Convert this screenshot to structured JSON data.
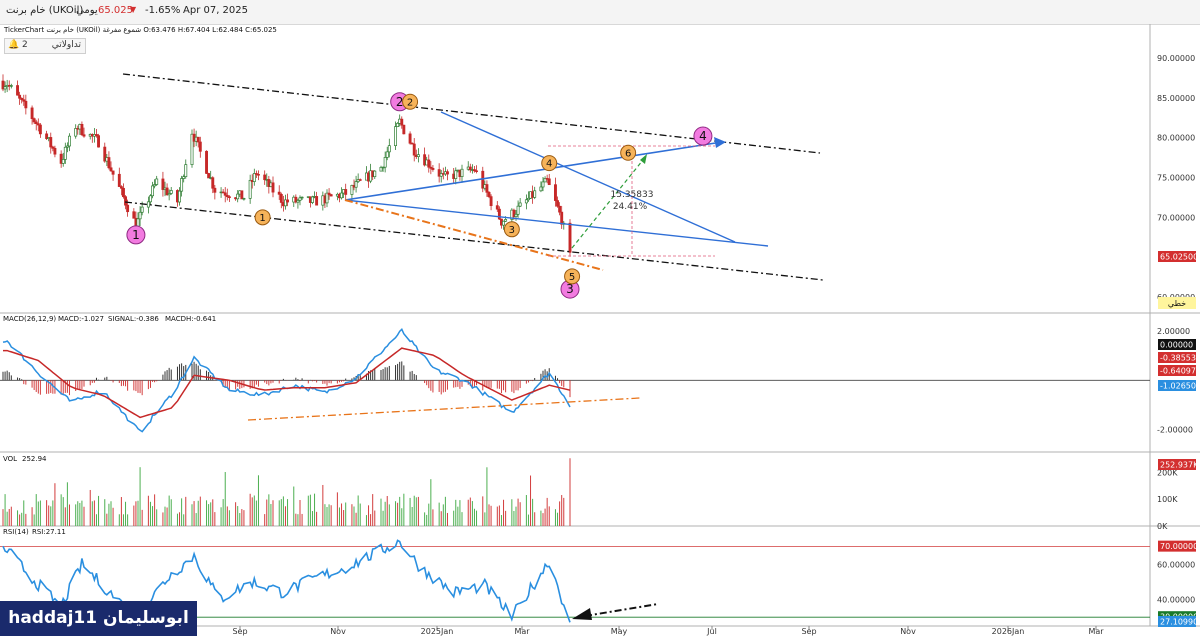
{
  "header": {
    "symbol_label": "خام برنت (UKOil)",
    "period": "يومي",
    "last_price": "65.025",
    "change_pct": "-1.65%",
    "date": "Apr 07, 2025",
    "ohlc_line": "TickerChart  خام برنت (UKOil)  شموع مفرغة  O:63.476  H:67.404  L:62.484  C:65.025",
    "trade_button": "تداولاتي",
    "alerts_count": "2",
    "down_color": "#d32f2f"
  },
  "watermark": "haddaj11 ابوسليمان",
  "chart_data": [
    {
      "type": "candlestick",
      "name": "price",
      "ylim": [
        58,
        93
      ],
      "y_ticks": [
        "90.00000",
        "85.00000",
        "80.00000",
        "75.00000",
        "70.00000",
        "60.00000"
      ],
      "last_value_label": "65.02500",
      "line_style_label": "خطي",
      "x_ticks": [
        "Sep",
        "Nov",
        "2025Jan",
        "Mar",
        "May",
        "Jul",
        "Sep",
        "Nov",
        "2026Jan",
        "Mar"
      ],
      "anchor_closes": [
        [
          "2024-07-10",
          86.8
        ],
        [
          "2024-07-25",
          81.5
        ],
        [
          "2024-08-05",
          77.0
        ],
        [
          "2024-08-12",
          81.5
        ],
        [
          "2024-08-23",
          79.5
        ],
        [
          "2024-09-10",
          69.0
        ],
        [
          "2024-09-20",
          74.5
        ],
        [
          "2024-09-30",
          72.0
        ],
        [
          "2024-10-07",
          80.8
        ],
        [
          "2024-10-18",
          73.5
        ],
        [
          "2024-11-01",
          72.5
        ],
        [
          "2024-11-07",
          75.6
        ],
        [
          "2024-11-20",
          72.0
        ],
        [
          "2024-12-05",
          72.0
        ],
        [
          "2024-12-20",
          73.0
        ],
        [
          "2025-01-06",
          76.3
        ],
        [
          "2025-01-15",
          82.0
        ],
        [
          "2025-01-22",
          78.5
        ],
        [
          "2025-02-05",
          75.0
        ],
        [
          "2025-02-20",
          76.0
        ],
        [
          "2025-03-05",
          69.5
        ],
        [
          "2025-03-12",
          70.8
        ],
        [
          "2025-03-27",
          74.5
        ],
        [
          "2025-04-03",
          69.8
        ],
        [
          "2025-04-07",
          65.0
        ]
      ],
      "measure": {
        "value": "15.35833",
        "percent": "24.41%"
      },
      "waves_big": [
        {
          "label": "1",
          "date": "2024-09-10",
          "value": 67.8
        },
        {
          "label": "2",
          "date": "2025-01-15",
          "value": 84.5
        },
        {
          "label": "3",
          "date": "2025-04-07",
          "value": 61.0
        },
        {
          "label": "4",
          "date": "2025-06-10",
          "value": 80.2
        }
      ],
      "waves_small": [
        {
          "label": "1",
          "date": "2024-11-10",
          "value": 70.0
        },
        {
          "label": "2",
          "date": "2025-01-20",
          "value": 84.5
        },
        {
          "label": "3",
          "date": "2025-03-10",
          "value": 68.5
        },
        {
          "label": "4",
          "date": "2025-03-28",
          "value": 76.8
        },
        {
          "label": "5",
          "date": "2025-04-08",
          "value": 62.6
        },
        {
          "label": "6",
          "date": "2025-05-05",
          "value": 78.1
        }
      ]
    },
    {
      "type": "line",
      "name": "MACD",
      "label": "MACD(26,12,9)",
      "macd_text": "MACD:-1.027",
      "signal_text": "SIGNAL:-0.386",
      "hist_text": "MACDH:-0.641",
      "ylim": [
        -2.9,
        2.6
      ],
      "y_ticks": [
        "2.00000",
        "-2.00000"
      ],
      "value_labels": [
        "0.00000",
        "-0.38553",
        "-0.64097",
        "-1.02650"
      ],
      "macd_anchors": [
        [
          "2024-07-10",
          1.6
        ],
        [
          "2024-07-25",
          0.3
        ],
        [
          "2024-08-10",
          -0.9
        ],
        [
          "2024-08-25",
          -0.4
        ],
        [
          "2024-09-12",
          -2.1
        ],
        [
          "2024-09-28",
          -0.5
        ],
        [
          "2024-10-08",
          0.9
        ],
        [
          "2024-10-25",
          -0.4
        ],
        [
          "2024-11-10",
          -0.6
        ],
        [
          "2024-11-25",
          -0.2
        ],
        [
          "2024-12-10",
          -0.5
        ],
        [
          "2024-12-25",
          0.1
        ],
        [
          "2025-01-16",
          2.0
        ],
        [
          "2025-02-01",
          0.4
        ],
        [
          "2025-02-15",
          0.0
        ],
        [
          "2025-03-10",
          -1.3
        ],
        [
          "2025-03-28",
          0.3
        ],
        [
          "2025-04-07",
          -1.0
        ]
      ],
      "signal_anchors": [
        [
          "2024-07-10",
          1.2
        ],
        [
          "2024-07-25",
          0.8
        ],
        [
          "2024-08-10",
          -0.3
        ],
        [
          "2024-08-25",
          -0.6
        ],
        [
          "2024-09-12",
          -1.5
        ],
        [
          "2024-09-28",
          -1.1
        ],
        [
          "2024-10-08",
          0.2
        ],
        [
          "2024-10-25",
          0.0
        ],
        [
          "2024-11-10",
          -0.4
        ],
        [
          "2024-11-25",
          -0.3
        ],
        [
          "2024-12-10",
          -0.3
        ],
        [
          "2024-12-25",
          -0.1
        ],
        [
          "2025-01-16",
          1.3
        ],
        [
          "2025-02-01",
          1.0
        ],
        [
          "2025-02-15",
          0.2
        ],
        [
          "2025-03-10",
          -0.8
        ],
        [
          "2025-03-28",
          -0.2
        ],
        [
          "2025-04-07",
          -0.4
        ]
      ]
    },
    {
      "type": "bar",
      "name": "volume",
      "label": "VOL",
      "value_text": "252.94",
      "y_ticks": [
        "200K",
        "100K",
        "0K"
      ],
      "last_value_label": "252.937K",
      "ylim": [
        0,
        265
      ],
      "base_volume": 90,
      "last_volume": 252.9
    },
    {
      "type": "line",
      "name": "RSI",
      "label": "RSI(14)",
      "value_text": "RSI:27.11",
      "ylim": [
        25,
        80
      ],
      "y_ticks": [
        "60.00000",
        "40.00000"
      ],
      "levels": [
        "70.00000",
        "30.00000"
      ],
      "last_value_label": "27.10990",
      "anchors": [
        [
          "2024-07-10",
          68
        ],
        [
          "2024-07-22",
          52
        ],
        [
          "2024-08-05",
          36
        ],
        [
          "2024-08-15",
          60
        ],
        [
          "2024-08-25",
          48
        ],
        [
          "2024-09-10",
          30
        ],
        [
          "2024-09-25",
          52
        ],
        [
          "2024-10-08",
          65
        ],
        [
          "2024-10-20",
          40
        ],
        [
          "2024-11-05",
          50
        ],
        [
          "2024-11-20",
          44
        ],
        [
          "2024-12-05",
          52
        ],
        [
          "2024-12-20",
          58
        ],
        [
          "2025-01-15",
          73
        ],
        [
          "2025-01-25",
          58
        ],
        [
          "2025-02-10",
          44
        ],
        [
          "2025-02-25",
          48
        ],
        [
          "2025-03-10",
          30
        ],
        [
          "2025-03-28",
          62
        ],
        [
          "2025-04-07",
          27
        ]
      ]
    }
  ]
}
